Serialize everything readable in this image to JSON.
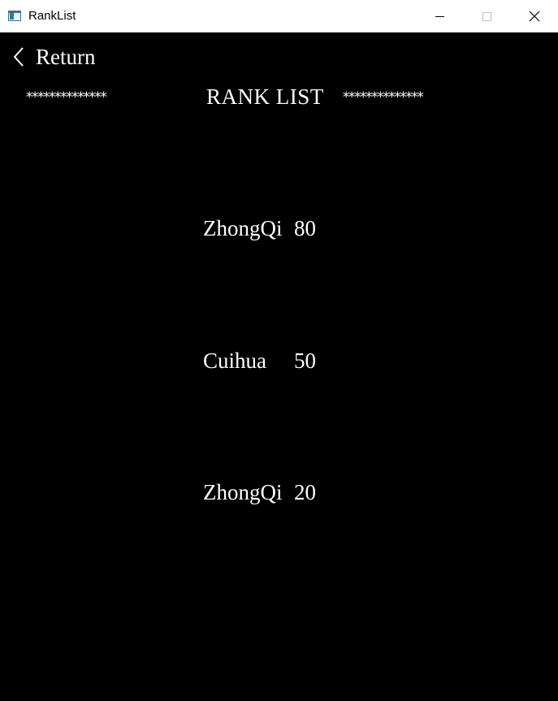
{
  "window": {
    "title": "RankList",
    "icon": "app-window-icon"
  },
  "nav": {
    "return_label": "Return",
    "return_icon": "chevron-left-icon"
  },
  "header": {
    "stars_left": "**************",
    "title": "RANK LIST",
    "stars_right": "**************"
  },
  "rankings": [
    {
      "name": "ZhongQi",
      "score": "80"
    },
    {
      "name": "Cuihua",
      "score": "50"
    },
    {
      "name": "ZhongQi",
      "score": "20"
    }
  ],
  "colors": {
    "background": "#000000",
    "text": "#ffffff",
    "titlebar": "#ffffff"
  }
}
